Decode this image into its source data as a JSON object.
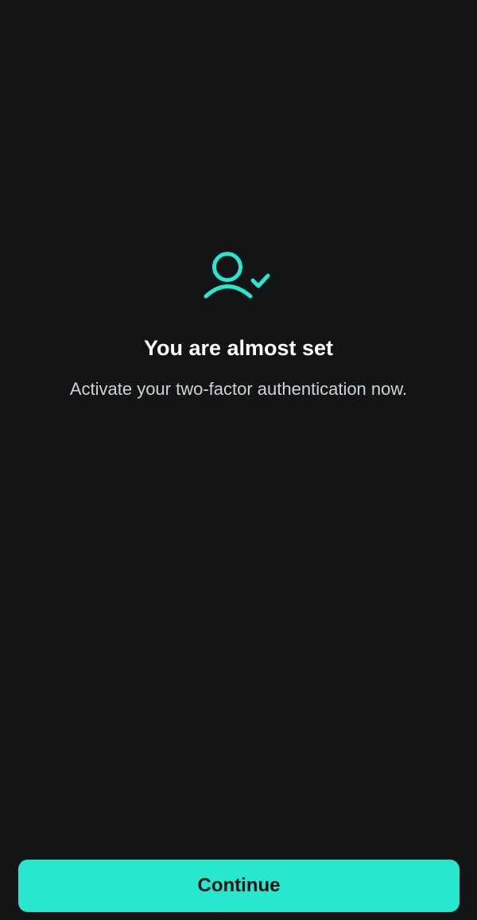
{
  "icon": "user-check-icon",
  "colors": {
    "background": "#121416",
    "accent": "#27e8cf",
    "title_text": "#ffffff",
    "subtitle_text": "#cfd2d4",
    "button_text": "#111315"
  },
  "main": {
    "title": "You are almost set",
    "subtitle": "Activate your two-factor authentication now."
  },
  "footer": {
    "continue_label": "Continue"
  }
}
